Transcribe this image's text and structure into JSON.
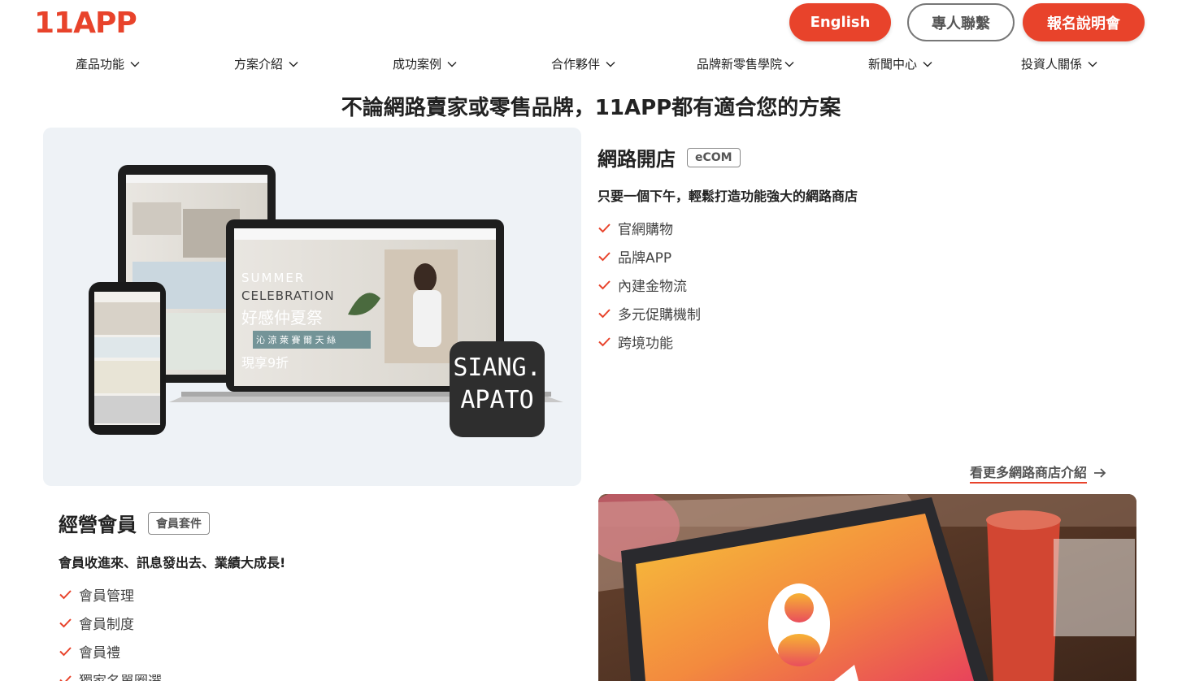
{
  "header": {
    "logo": "11APP",
    "buttons": {
      "english": "English",
      "contact": "專人聯繫",
      "event": "報名說明會"
    }
  },
  "nav": {
    "items": [
      {
        "label": "產品功能"
      },
      {
        "label": "方案介紹"
      },
      {
        "label": "成功案例"
      },
      {
        "label": "合作夥伴"
      },
      {
        "label": "品牌新零售學院"
      },
      {
        "label": "新聞中心"
      },
      {
        "label": "投資人關係"
      }
    ]
  },
  "headline": "不論網路賣家或零售品牌，11APP都有適合您的方案",
  "ecom": {
    "title": "網路開店",
    "tag": "eCOM",
    "subtitle": "只要一個下午，輕鬆打造功能強大的網路商店",
    "features": [
      "官網購物",
      "品牌APP",
      "內建金物流",
      "多元促購機制",
      "跨境功能"
    ],
    "more_link": "看更多網路商店介紹",
    "mockup": {
      "slide_line1": "SUMMER",
      "slide_line2": "CELEBRATION",
      "slide_line3": "好感仲夏祭",
      "slide_band": "沁 涼 萊 賽 爾 天 絲",
      "slide_price": "現享9折",
      "brand_line1": "SIANG.",
      "brand_line2": "APATO"
    }
  },
  "member": {
    "title": "經營會員",
    "tag": "會員套件",
    "subtitle": "會員收進來、訊息發出去、業績大成長!",
    "features": [
      "會員管理",
      "會員制度",
      "會員禮",
      "獨家名單圈選"
    ]
  },
  "colors": {
    "brand": "#e8432b",
    "text": "#222222",
    "panel_bg": "#eef2f6"
  }
}
